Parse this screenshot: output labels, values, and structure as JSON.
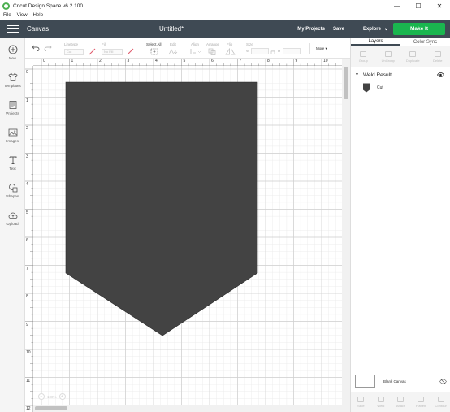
{
  "window": {
    "title": "Cricut Design Space  v6.2.100",
    "controls": [
      "—",
      "☐",
      "✕"
    ]
  },
  "menu": [
    "File",
    "View",
    "Help"
  ],
  "header": {
    "section": "Canvas",
    "doc_title": "Untitled*",
    "my_projects": "My Projects",
    "save": "Save",
    "explore": "Explore",
    "make_it": "Make It"
  },
  "left_sidebar": [
    {
      "label": "New",
      "icon": "plus-circle-icon"
    },
    {
      "label": "Templates",
      "icon": "shirt-icon"
    },
    {
      "label": "Projects",
      "icon": "projects-icon"
    },
    {
      "label": "Images",
      "icon": "image-icon"
    },
    {
      "label": "Text",
      "icon": "text-icon"
    },
    {
      "label": "Shapes",
      "icon": "shapes-icon"
    },
    {
      "label": "Upload",
      "icon": "cloud-upload-icon"
    }
  ],
  "toolbar": {
    "linetype_label": "Linetype",
    "linetype_value": "Cut",
    "fill_label": "Fill",
    "fill_value": "No Fill",
    "select_all": "Select All",
    "edit": "Edit",
    "align": "Align",
    "arrange": "Arrange",
    "flip": "Flip",
    "size": "Size",
    "size_w": "W",
    "size_h": "H",
    "more": "More"
  },
  "canvas": {
    "ruler_top": [
      "0",
      "1",
      "2",
      "3",
      "4",
      "5",
      "6",
      "7",
      "8",
      "9",
      "10"
    ],
    "ruler_left": [
      "0",
      "1",
      "2",
      "3",
      "4",
      "5",
      "6",
      "7",
      "8",
      "9",
      "10",
      "11",
      "12"
    ],
    "shape_color": "#434343",
    "zoom": "100%"
  },
  "right_panel": {
    "tabs": [
      "Layers",
      "Color Sync"
    ],
    "tools": [
      "Group",
      "UnGroup",
      "Duplicate",
      "Delete"
    ],
    "layer_group": "Weld Result",
    "layer_item": "Cut",
    "blank_canvas": "Blank Canvas",
    "bottom_tools": [
      "Slice",
      "Weld",
      "Attach",
      "Flatten",
      "Contour"
    ]
  }
}
